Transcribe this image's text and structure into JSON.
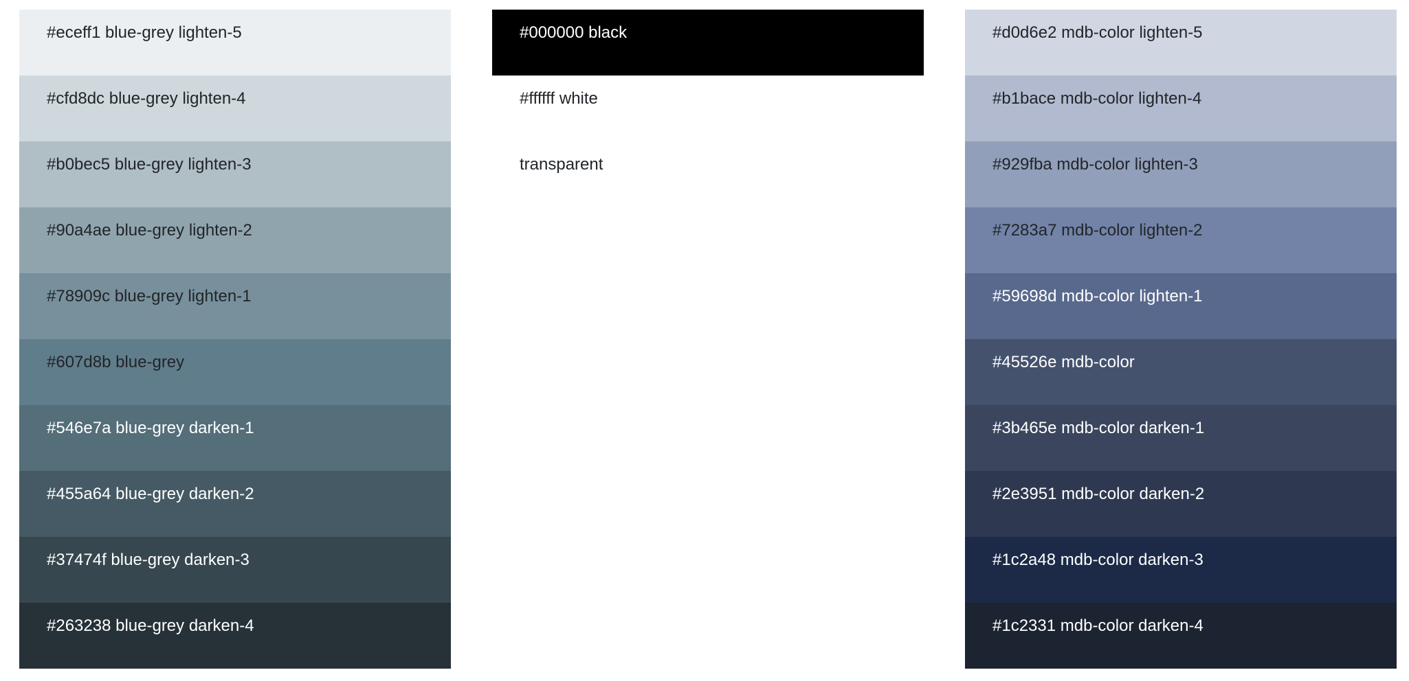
{
  "columns": [
    {
      "id": "col-blue-grey",
      "swatches": [
        {
          "label": "#eceff1 blue-grey lighten-5",
          "bg": "#eceff1",
          "fg": "#212529"
        },
        {
          "label": "#cfd8dc blue-grey lighten-4",
          "bg": "#cfd8dc",
          "fg": "#212529"
        },
        {
          "label": "#b0bec5 blue-grey lighten-3",
          "bg": "#b0bec5",
          "fg": "#212529"
        },
        {
          "label": "#90a4ae blue-grey lighten-2",
          "bg": "#90a4ae",
          "fg": "#212529"
        },
        {
          "label": "#78909c blue-grey lighten-1",
          "bg": "#78909c",
          "fg": "#212529"
        },
        {
          "label": "#607d8b blue-grey",
          "bg": "#607d8b",
          "fg": "#212529"
        },
        {
          "label": "#546e7a blue-grey darken-1",
          "bg": "#546e7a",
          "fg": "#ffffff"
        },
        {
          "label": "#455a64 blue-grey darken-2",
          "bg": "#455a64",
          "fg": "#ffffff"
        },
        {
          "label": "#37474f blue-grey darken-3",
          "bg": "#37474f",
          "fg": "#ffffff"
        },
        {
          "label": "#263238 blue-grey darken-4",
          "bg": "#263238",
          "fg": "#ffffff"
        }
      ]
    },
    {
      "id": "col-basic",
      "swatches": [
        {
          "label": "#000000 black",
          "bg": "#000000",
          "fg": "#ffffff"
        },
        {
          "label": "#ffffff white",
          "bg": "#ffffff",
          "fg": "#212529"
        },
        {
          "label": "transparent",
          "bg": "transparent",
          "fg": "#212529"
        }
      ]
    },
    {
      "id": "col-mdb",
      "swatches": [
        {
          "label": "#d0d6e2 mdb-color lighten-5",
          "bg": "#d0d6e2",
          "fg": "#212529"
        },
        {
          "label": "#b1bace mdb-color lighten-4",
          "bg": "#b1bace",
          "fg": "#212529"
        },
        {
          "label": "#929fba mdb-color lighten-3",
          "bg": "#929fba",
          "fg": "#212529"
        },
        {
          "label": "#7283a7 mdb-color lighten-2",
          "bg": "#7283a7",
          "fg": "#212529"
        },
        {
          "label": "#59698d mdb-color lighten-1",
          "bg": "#59698d",
          "fg": "#ffffff"
        },
        {
          "label": "#45526e mdb-color",
          "bg": "#45526e",
          "fg": "#ffffff"
        },
        {
          "label": "#3b465e mdb-color darken-1",
          "bg": "#3b465e",
          "fg": "#ffffff"
        },
        {
          "label": "#2e3951 mdb-color darken-2",
          "bg": "#2e3951",
          "fg": "#ffffff"
        },
        {
          "label": "#1c2a48 mdb-color darken-3",
          "bg": "#1c2a48",
          "fg": "#ffffff"
        },
        {
          "label": "#1c2331 mdb-color darken-4",
          "bg": "#1c2331",
          "fg": "#ffffff"
        }
      ]
    }
  ]
}
